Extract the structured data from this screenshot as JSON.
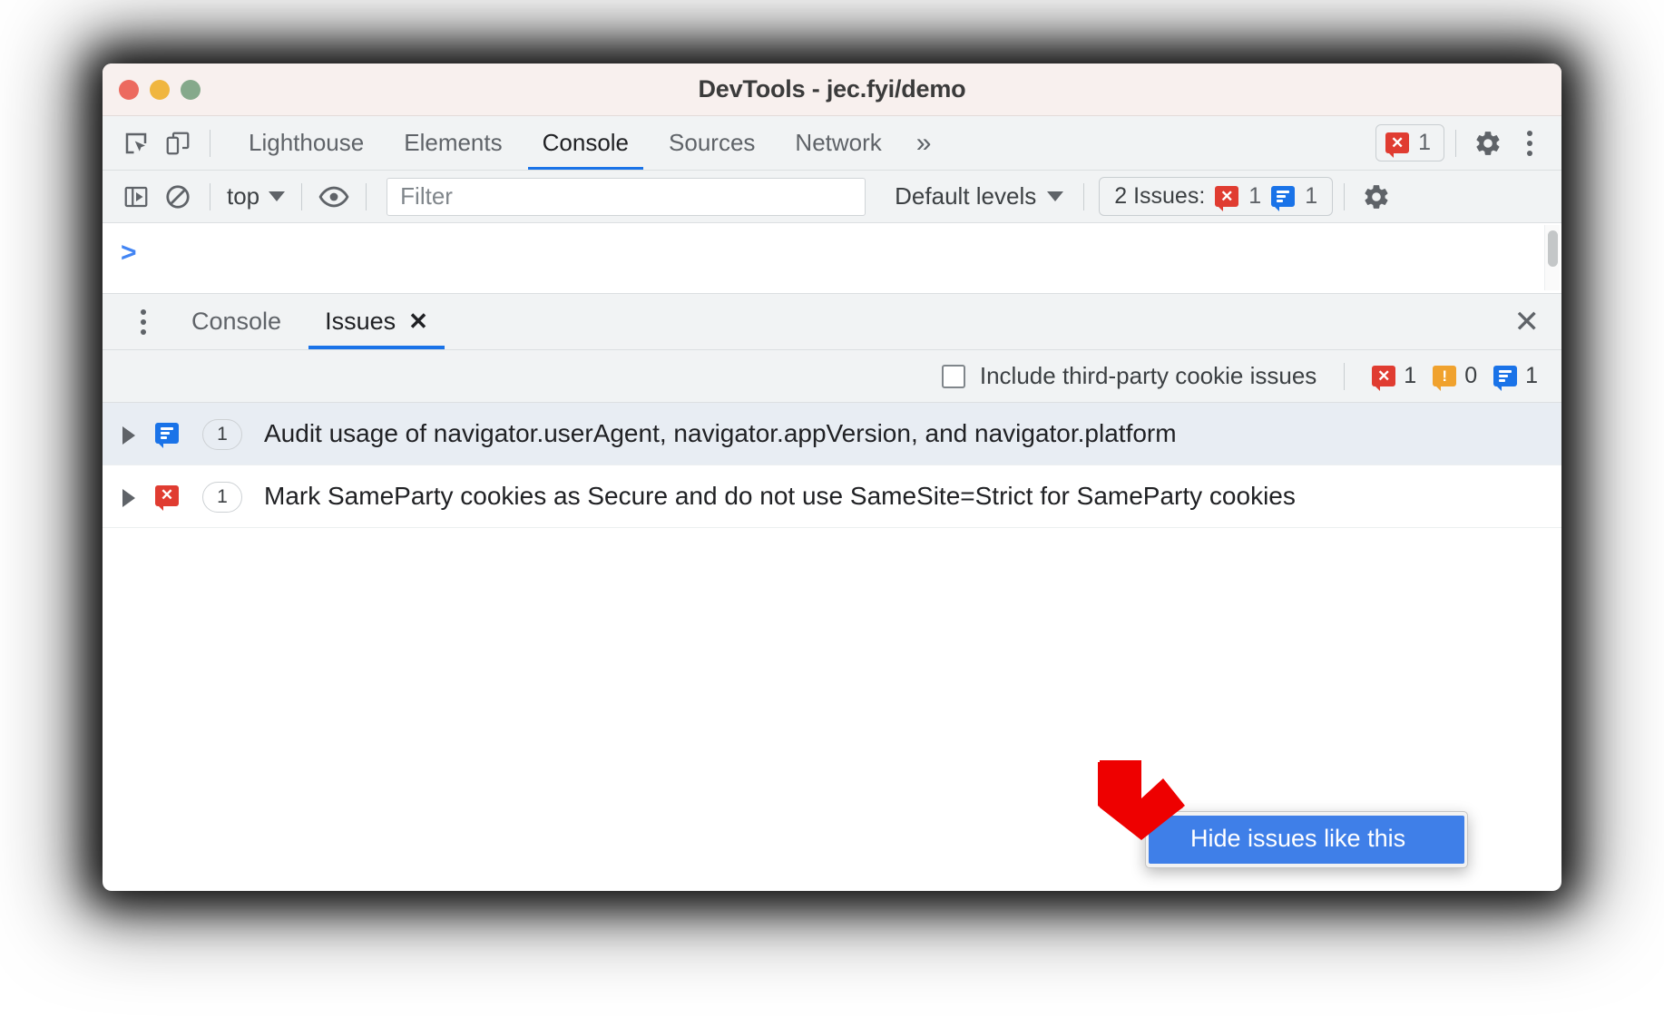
{
  "window": {
    "title": "DevTools - jec.fyi/demo",
    "traffic_lights": [
      "close-red",
      "minimize-yellow",
      "zoom-green"
    ]
  },
  "main_tabbar": {
    "left_icons": [
      "inspect-element-icon",
      "device-toolbar-icon"
    ],
    "tabs": [
      {
        "label": "Lighthouse",
        "active": false
      },
      {
        "label": "Elements",
        "active": false
      },
      {
        "label": "Console",
        "active": true
      },
      {
        "label": "Sources",
        "active": false
      },
      {
        "label": "Network",
        "active": false
      }
    ],
    "more_tabs_label": "»",
    "error_badge_count": "1",
    "right_icons": [
      "settings-gear-icon",
      "more-options-kebab-icon"
    ]
  },
  "console_toolbar": {
    "sidebar_toggle_icon": "show-console-sidebar-icon",
    "clear_icon": "clear-console-icon",
    "context_selector": "top",
    "eye_icon": "live-expression-eye-icon",
    "filter_placeholder": "Filter",
    "filter_value": "",
    "levels_label": "Default levels",
    "issues_label": "2 Issues:",
    "issues_error_count": "1",
    "issues_info_count": "1",
    "settings_icon": "console-settings-gear-icon"
  },
  "console_output": {
    "prompt_symbol": ">"
  },
  "drawer": {
    "kebab_icon": "more-tools-kebab-icon",
    "tabs": [
      {
        "label": "Console",
        "active": false,
        "closable": false
      },
      {
        "label": "Issues",
        "active": true,
        "closable": true,
        "close_glyph": "✕"
      }
    ],
    "close_drawer_glyph": "✕"
  },
  "issues_bar": {
    "checkbox_label": "Include third-party cookie issues",
    "checkbox_checked": false,
    "counts": [
      {
        "kind": "error",
        "value": "1"
      },
      {
        "kind": "warning",
        "value": "0"
      },
      {
        "kind": "info",
        "value": "1"
      }
    ]
  },
  "issues": [
    {
      "kind": "info",
      "count": "1",
      "text": "Audit usage of navigator.userAgent, navigator.appVersion, and navigator.platform",
      "hovered": true,
      "expand_glyph": "▶"
    },
    {
      "kind": "error",
      "count": "1",
      "text": "Mark SameParty cookies as Secure and do not use SameSite=Strict for SameParty cookies",
      "hovered": false,
      "expand_glyph": "▶"
    }
  ],
  "context_menu": {
    "items": [
      {
        "label": "Hide issues like this",
        "highlighted": true
      }
    ]
  },
  "annotation": {
    "arrow": "red-pointer-arrow",
    "arrow_color": "#ee0000"
  },
  "colors": {
    "accent_blue": "#1a73e8",
    "error_red": "#e03c31",
    "warning_orange": "#f0a22e",
    "info_blue": "#1a73e8",
    "titlebar_bg": "#f8f0ee",
    "toolbar_bg": "#f1f3f4",
    "menu_highlight": "#3f7fe8"
  }
}
